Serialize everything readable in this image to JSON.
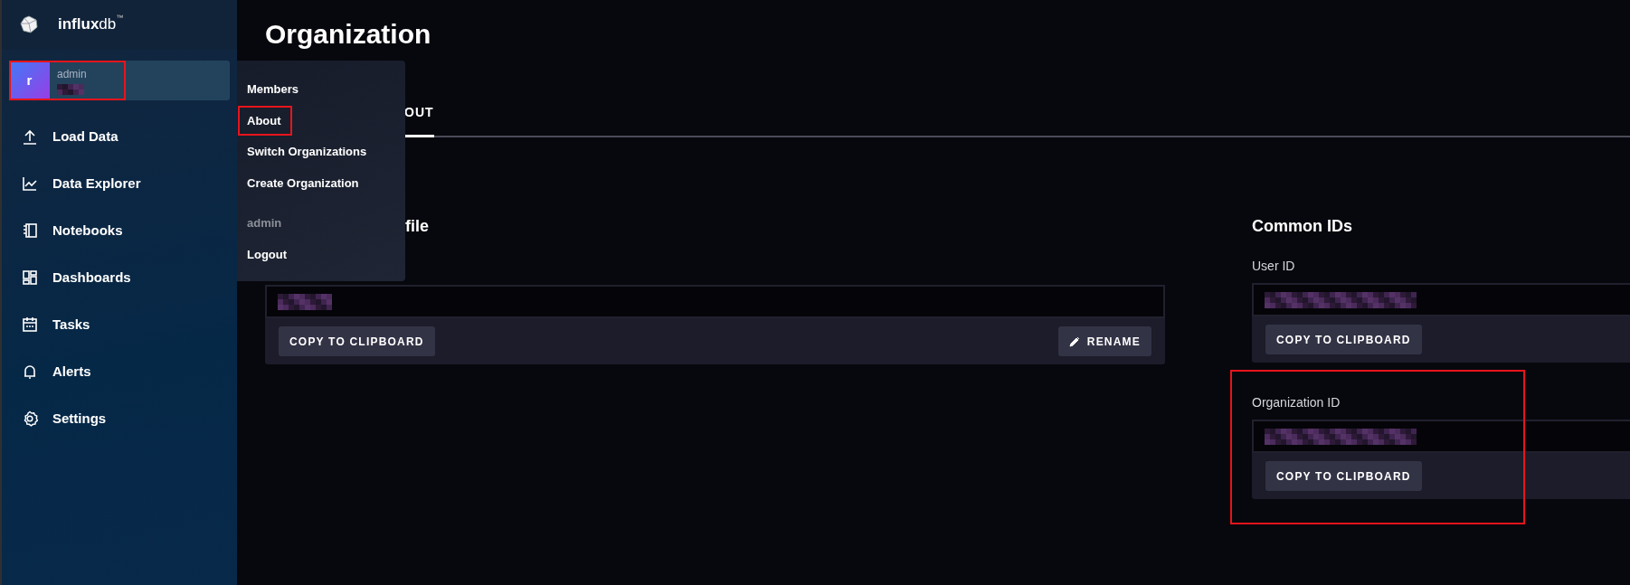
{
  "sidebar": {
    "logo": {
      "wordmark_bold": "influx",
      "wordmark_light": "db",
      "trademark": "™"
    },
    "user": {
      "avatar_letter": "r",
      "name": "admin",
      "redacted": true,
      "highlighted": true
    },
    "items": [
      {
        "label": "Load Data"
      },
      {
        "label": "Data Explorer"
      },
      {
        "label": "Notebooks"
      },
      {
        "label": "Dashboards"
      },
      {
        "label": "Tasks"
      },
      {
        "label": "Alerts"
      },
      {
        "label": "Settings"
      }
    ]
  },
  "user_menu": {
    "items": [
      {
        "kind": "link",
        "label": "Members",
        "highlighted": false
      },
      {
        "kind": "link",
        "label": "About",
        "highlighted": true
      },
      {
        "kind": "link",
        "label": "Switch Organizations",
        "highlighted": false
      },
      {
        "kind": "link",
        "label": "Create Organization",
        "highlighted": false
      },
      {
        "kind": "heading",
        "label": "admin",
        "highlighted": false
      },
      {
        "kind": "link",
        "label": "Logout",
        "highlighted": false
      }
    ]
  },
  "page": {
    "title": "Organization",
    "tabs": [
      {
        "label": "OUT",
        "selected": true
      }
    ],
    "profile": {
      "heading": "file",
      "field": {
        "redacted": true
      },
      "buttons": [
        {
          "kind": "plain",
          "label": "COPY TO CLIPBOARD"
        },
        {
          "kind": "edit",
          "label": "RENAME"
        }
      ]
    },
    "common_ids": {
      "heading": "Common IDs",
      "ids": [
        {
          "label": "User ID",
          "redacted": true,
          "button": "COPY TO CLIPBOARD",
          "highlighted": false
        },
        {
          "label": "Organization ID",
          "redacted": true,
          "button": "COPY TO CLIPBOARD",
          "highlighted": true
        }
      ]
    }
  }
}
